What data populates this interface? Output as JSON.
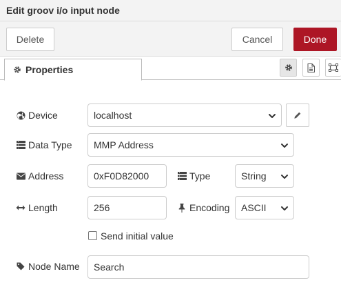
{
  "header": {
    "title": "Edit groov i/o input node"
  },
  "toolbar": {
    "delete_label": "Delete",
    "cancel_label": "Cancel",
    "done_label": "Done"
  },
  "tabs": {
    "properties_label": "Properties"
  },
  "form": {
    "device": {
      "label": "Device",
      "value": "localhost"
    },
    "data_type": {
      "label": "Data Type",
      "value": "MMP Address"
    },
    "address": {
      "label": "Address",
      "value": "0xF0D82000"
    },
    "type": {
      "label": "Type",
      "value": "String"
    },
    "length": {
      "label": "Length",
      "value": "256"
    },
    "encoding": {
      "label": "Encoding",
      "value": "ASCII"
    },
    "send_initial": {
      "label": "Send initial value",
      "checked": false
    },
    "node_name": {
      "label": "Node Name",
      "value": "Search"
    }
  },
  "colors": {
    "done_button": "#ad1625",
    "header_bg": "#f3f3f3"
  },
  "icons": [
    "gear-icon",
    "document-icon",
    "frame-icon",
    "globe-icon",
    "table-icon",
    "envelope-icon",
    "arrows-horizontal-icon",
    "thumbtack-icon",
    "tag-icon",
    "pencil-icon",
    "chevron-down-icon"
  ]
}
